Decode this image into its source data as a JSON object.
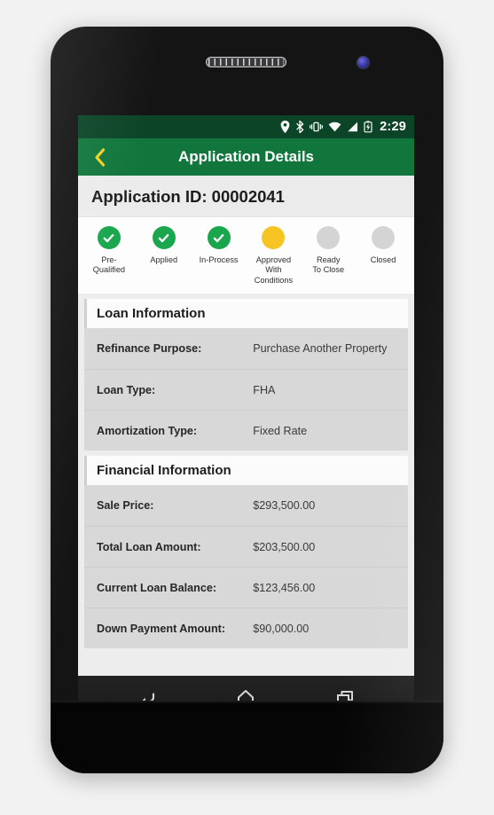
{
  "device": {
    "earpiece": "earpiece-speaker",
    "camera": "front-camera"
  },
  "status_bar": {
    "time": "2:29",
    "icons": [
      "location-icon",
      "bluetooth-icon",
      "vibrate-icon",
      "wifi-icon",
      "cell-signal-icon",
      "battery-icon"
    ]
  },
  "app_bar": {
    "back_icon": "back-chevron-icon",
    "title": "Application Details",
    "background_color": "#11763c",
    "accent_color": "#f6c524"
  },
  "header": {
    "application_id": "Application ID: 00002041"
  },
  "stepper": {
    "steps": [
      {
        "label": "Pre-\nQualified",
        "state": "done"
      },
      {
        "label": "Applied",
        "state": "done"
      },
      {
        "label": "In-Process",
        "state": "done"
      },
      {
        "label": "Approved\nWith\nConditions",
        "state": "active"
      },
      {
        "label": "Ready\nTo Close",
        "state": "todo"
      },
      {
        "label": "Closed",
        "state": "todo"
      }
    ],
    "colors": {
      "done": "#19a64d",
      "active": "#f6c524",
      "todo": "#d4d4d4"
    }
  },
  "sections": [
    {
      "title": "Loan Information",
      "rows": [
        {
          "label": "Refinance Purpose:",
          "value": "Purchase Another Property"
        },
        {
          "label": "Loan Type:",
          "value": "FHA"
        },
        {
          "label": "Amortization Type:",
          "value": "Fixed Rate"
        }
      ]
    },
    {
      "title": "Financial Information",
      "rows": [
        {
          "label": "Sale Price:",
          "value": "$293,500.00"
        },
        {
          "label": "Total Loan Amount:",
          "value": "$203,500.00"
        },
        {
          "label": "Current Loan Balance:",
          "value": "$123,456.00"
        },
        {
          "label": "Down Payment Amount:",
          "value": "$90,000.00"
        }
      ]
    }
  ],
  "nav_bar": {
    "buttons": [
      "back-nav-icon",
      "home-nav-icon",
      "recents-nav-icon"
    ]
  }
}
